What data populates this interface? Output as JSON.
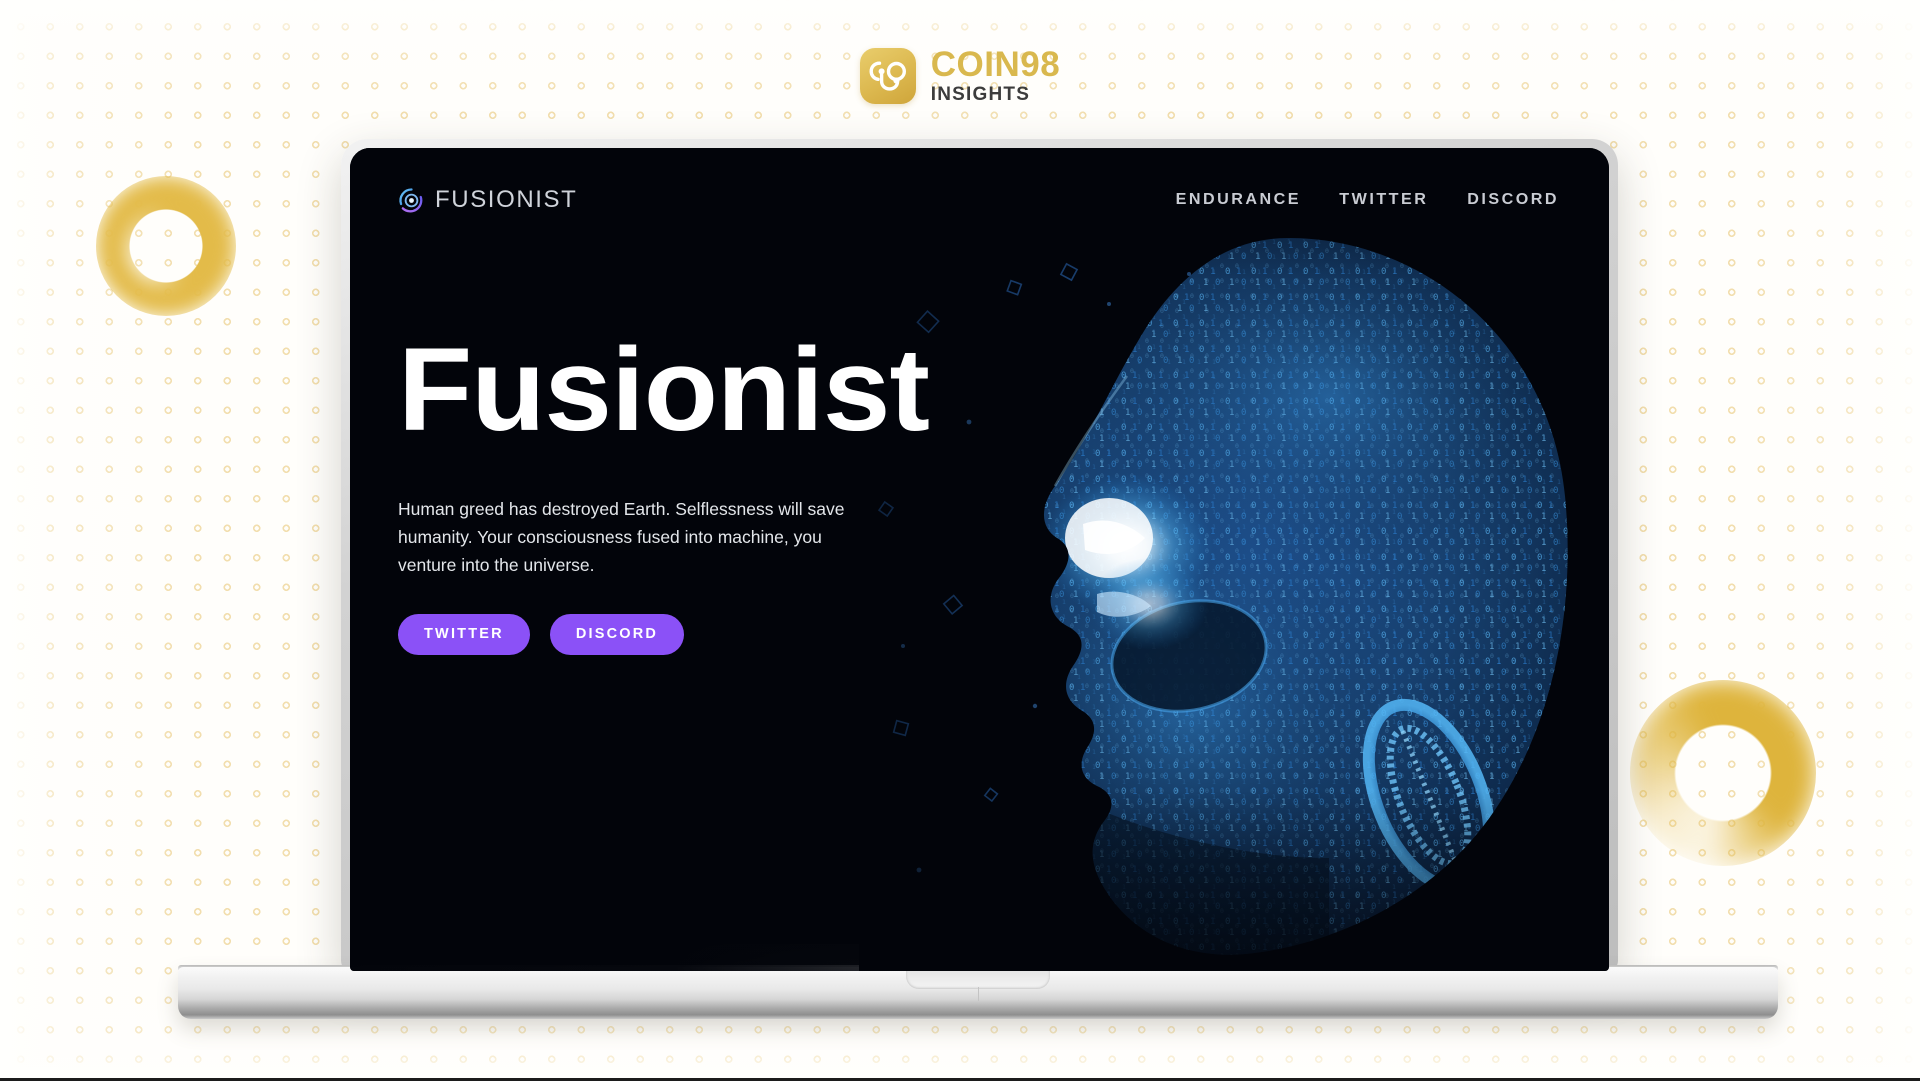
{
  "brand": {
    "name": "COIN98",
    "subtitle": "INSIGHTS",
    "mark_icon": "coin98-logo-icon",
    "colors": {
      "gold": "#d9b84e",
      "subtitle": "#3c3c3c"
    }
  },
  "decor": {
    "ring_left_icon": "gold-torus-ring",
    "ring_right_icon": "gold-torus-ring",
    "dot_pattern_color": "#e0b342"
  },
  "device": {
    "type": "laptop-mockup",
    "body_color": "#d2d2d2",
    "screen_color": "#02040a"
  },
  "site": {
    "logo": {
      "text": "FUSIONIST",
      "icon": "fusionist-orbit-icon"
    },
    "nav": [
      {
        "label": "ENDURANCE",
        "name": "nav-link-endurance"
      },
      {
        "label": "TWITTER",
        "name": "nav-link-twitter"
      },
      {
        "label": "DISCORD",
        "name": "nav-link-discord"
      }
    ],
    "hero": {
      "title": "Fusionist",
      "paragraph": "Human greed has destroyed Earth. Selflessness will save humanity. Your consciousness fused into machine, you venture into the universe.",
      "buttons": [
        {
          "label": "TWITTER",
          "name": "hero-twitter-button",
          "color": "#8b51f7"
        },
        {
          "label": "DISCORD",
          "name": "hero-discord-button",
          "color": "#8b51f7"
        }
      ]
    },
    "artwork": {
      "name": "particle-head-artwork",
      "description": "Blue binary-digit particle head in profile",
      "accent": "#2f8fe8",
      "glow": "#dff2ff"
    }
  }
}
